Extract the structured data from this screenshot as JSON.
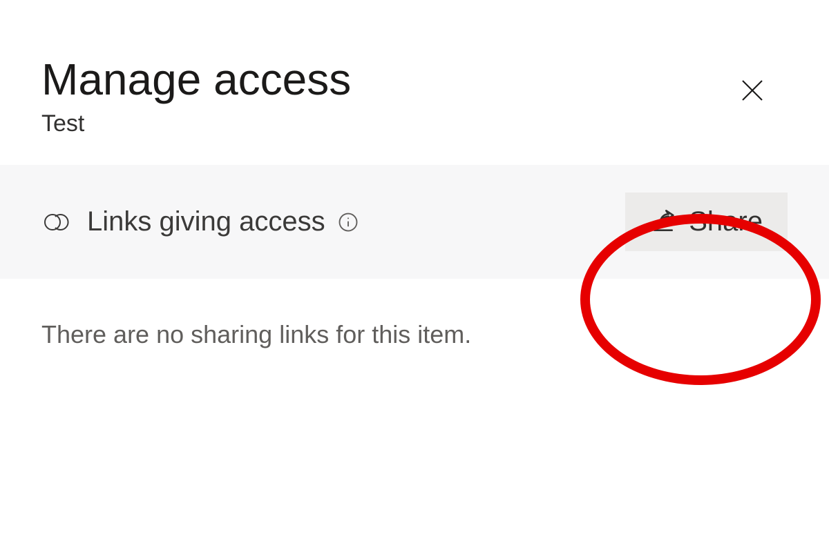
{
  "dialog": {
    "title": "Manage access",
    "item_name": "Test",
    "close_label": "Close"
  },
  "links_section": {
    "heading": "Links giving access",
    "info_tooltip": "Info",
    "share_button": "Share"
  },
  "empty_state": "There are no sharing links for this item."
}
